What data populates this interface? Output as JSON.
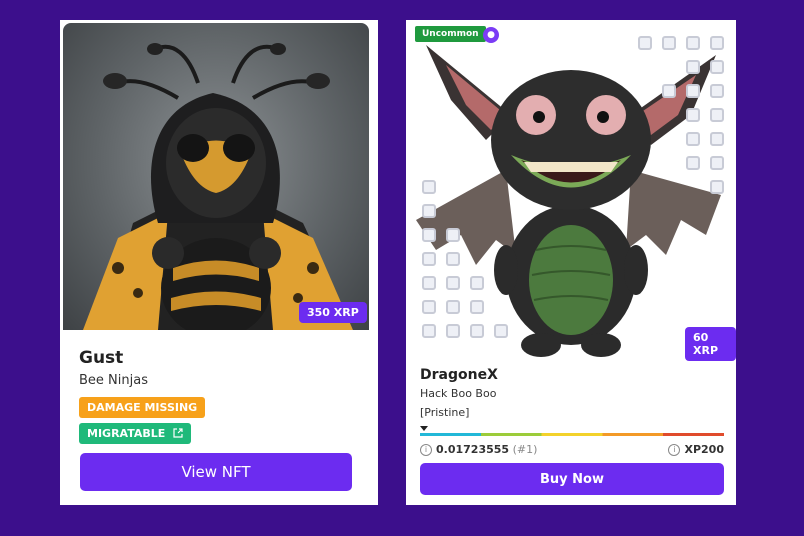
{
  "card1": {
    "name": "Gust",
    "collection": "Bee Ninjas",
    "price": "350 XRP",
    "badge_damage": "DAMAGE MISSING",
    "badge_migratable": "MIGRATABLE",
    "button": "View NFT"
  },
  "card2": {
    "rarity": "Uncommon",
    "price": "60 XRP",
    "name": "DragoneX",
    "collection": "Hack Boo Boo",
    "condition": "[Pristine]",
    "score": "0.01723555",
    "rank": "(#1)",
    "xp": "XP200",
    "button": "Buy Now"
  },
  "colors": {
    "page_bg": "#3c0f8c",
    "accent": "#6c2cf0",
    "badge_orange": "#f7a11a",
    "badge_green": "#1fb97a",
    "uncommon_green": "#1f9a3e"
  },
  "icons": {
    "external_link": "external-link-icon",
    "location_pin": "location-pin-icon",
    "info": "info-icon"
  }
}
